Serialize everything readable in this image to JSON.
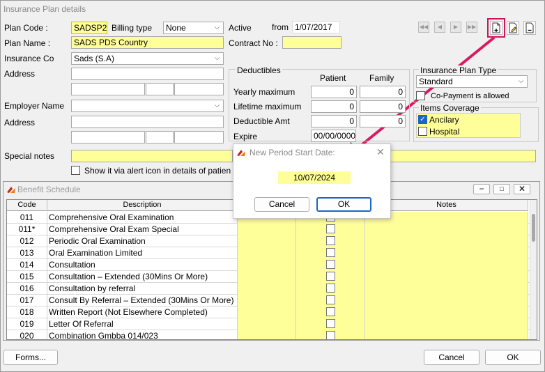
{
  "window": {
    "title": "Insurance Plan details"
  },
  "form": {
    "plan_code_label": "Plan Code :",
    "plan_code": "SADSP2",
    "billing_type_label": "Billing type",
    "billing_type": "None",
    "active_label": "Active",
    "from_label": "from",
    "from_date": "1/07/2017",
    "plan_name_label": "Plan Name :",
    "plan_name": "SADS PDS Country",
    "contract_no_label": "Contract No :",
    "contract_no": "",
    "insurance_co_label": "Insurance Co",
    "insurance_co": "Sads (S.A)",
    "address_label": "Address",
    "employer_name_label": "Employer Name",
    "employer_name": "",
    "address2_label": "Address",
    "special_notes_label": "Special notes",
    "special_notes": "",
    "alert_icon_label": "Show it via alert icon in details of patien"
  },
  "deductibles": {
    "title": "Deductibles",
    "col_patient": "Patient",
    "col_family": "Family",
    "rows": [
      {
        "label": "Yearly maximum",
        "patient": "0",
        "family": "0"
      },
      {
        "label": "Lifetime maximum",
        "patient": "0",
        "family": "0"
      },
      {
        "label": "Deductible Amt",
        "patient": "0",
        "family": "0"
      }
    ],
    "expire_label": "Expire",
    "expire_value": "00/00/0000"
  },
  "plan_type": {
    "title": "Insurance Plan Type",
    "value": "Standard",
    "copay_label": "Co-Payment is allowed"
  },
  "coverage": {
    "title": "Items Coverage",
    "items": [
      {
        "label": "Ancilary",
        "checked": true
      },
      {
        "label": "Hospital",
        "checked": false
      }
    ]
  },
  "toolbar": {
    "nav": [
      "first",
      "previous",
      "next",
      "last"
    ]
  },
  "benefit": {
    "title": "Benefit Schedule",
    "headers": {
      "code": "Code",
      "description": "Description",
      "notes": "Notes"
    },
    "rows": [
      {
        "code": "011",
        "desc": "Comprehensive Oral Examination"
      },
      {
        "code": "011*",
        "desc": "Comprehensive Oral Exam Special"
      },
      {
        "code": "012",
        "desc": "Periodic Oral Examination"
      },
      {
        "code": "013",
        "desc": "Oral Examination Limited"
      },
      {
        "code": "014",
        "desc": "Consultation"
      },
      {
        "code": "015",
        "desc": "Consultation – Extended (30Mins Or More)"
      },
      {
        "code": "016",
        "desc": "Consultation by referral"
      },
      {
        "code": "017",
        "desc": "Consult By Referral – Extended  (30Mins Or More)"
      },
      {
        "code": "018",
        "desc": "Written Report (Not Elsewhere Completed)"
      },
      {
        "code": "019",
        "desc": "Letter Of Referral"
      },
      {
        "code": "020",
        "desc": "Combination Gmbba 014/023"
      }
    ]
  },
  "dialog": {
    "title": "New Period Start Date:",
    "date": "10/07/2024",
    "cancel": "Cancel",
    "ok": "OK"
  },
  "footer": {
    "forms": "Forms...",
    "cancel": "Cancel",
    "ok": "OK"
  },
  "colors": {
    "highlight": "#c8185a",
    "field_yellow": "#ffff99",
    "accent": "#1b64c8"
  }
}
